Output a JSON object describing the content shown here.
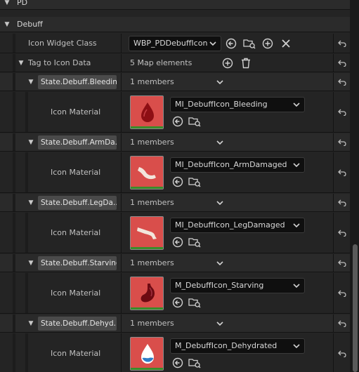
{
  "header": {
    "category_top": "PD",
    "category_debuff": "Debuff"
  },
  "icon_widget_class": {
    "label": "Icon Widget Class",
    "value": "WBP_PDDebuffIcon"
  },
  "tag_to_icon_data": {
    "label": "Tag to Icon Data",
    "count": "5 Map elements"
  },
  "entries": [
    {
      "tag": "State.Debuff.Bleeding",
      "members": "1 members",
      "material_label": "Icon Material",
      "material": "MI_DebuffIcon_Bleeding",
      "icon": "blood-drop-icon"
    },
    {
      "tag": "State.Debuff.ArmDa...",
      "members": "1 members",
      "material_label": "Icon Material",
      "material": "MI_DebuffIcon_ArmDamaged",
      "icon": "arm-icon"
    },
    {
      "tag": "State.Debuff.LegDa...",
      "members": "1 members",
      "material_label": "Icon Material",
      "material": "MI_DebuffIcon_LegDamaged",
      "icon": "leg-icon"
    },
    {
      "tag": "State.Debuff.Starving",
      "members": "1 members",
      "material_label": "Icon Material",
      "material": "M_DebuffIcon_Starving",
      "icon": "stomach-icon"
    },
    {
      "tag": "State.Debuff.Dehyd...",
      "members": "1 members",
      "material_label": "Icon Material",
      "material": "M_DebuffIcon_Dehydrated",
      "icon": "water-drop-icon"
    }
  ],
  "colors": {
    "panel": "#242424",
    "thumbnail": "#d94e4b",
    "thumbnail_bar": "#3b8c2a",
    "dropdown": "#0f0f0f"
  }
}
